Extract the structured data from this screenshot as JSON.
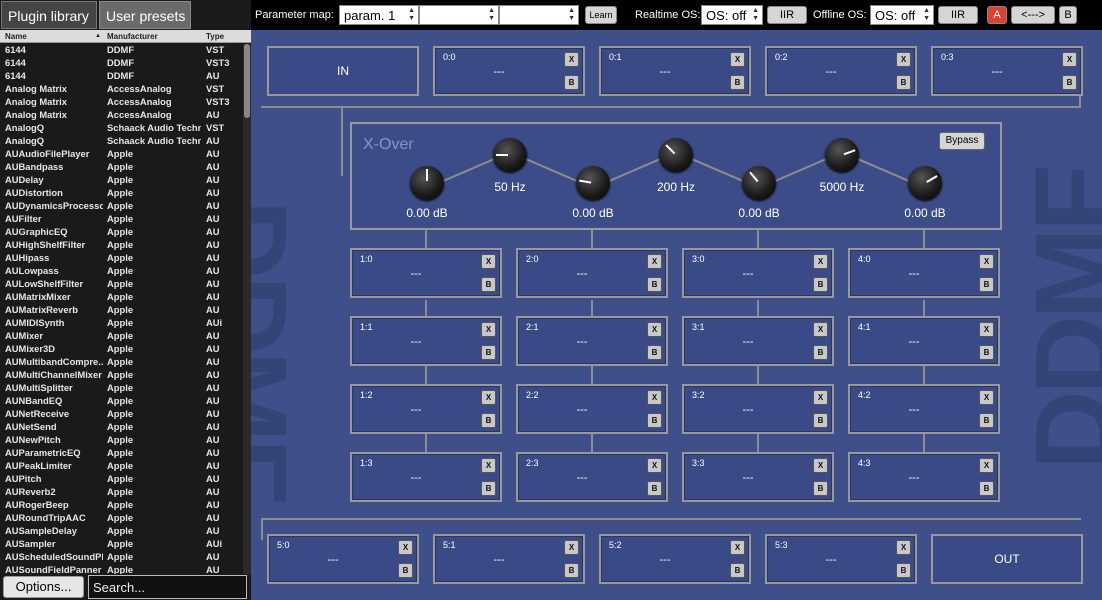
{
  "left_tabs": {
    "library": "Plugin library",
    "presets": "User presets"
  },
  "list_header": {
    "name": "Name",
    "manufacturer": "Manufacturer",
    "type": "Type"
  },
  "plugins": [
    [
      "6144",
      "DDMF",
      "VST"
    ],
    [
      "6144",
      "DDMF",
      "VST3"
    ],
    [
      "6144",
      "DDMF",
      "AU"
    ],
    [
      "Analog Matrix",
      "AccessAnalog",
      "VST"
    ],
    [
      "Analog Matrix",
      "AccessAnalog",
      "VST3"
    ],
    [
      "Analog Matrix",
      "AccessAnalog",
      "AU"
    ],
    [
      "AnalogQ",
      "Schaack Audio Techn...",
      "VST"
    ],
    [
      "AnalogQ",
      "Schaack Audio Techn...",
      "AU"
    ],
    [
      "AUAudioFilePlayer",
      "Apple",
      "AU"
    ],
    [
      "AUBandpass",
      "Apple",
      "AU"
    ],
    [
      "AUDelay",
      "Apple",
      "AU"
    ],
    [
      "AUDistortion",
      "Apple",
      "AU"
    ],
    [
      "AUDynamicsProcessor",
      "Apple",
      "AU"
    ],
    [
      "AUFilter",
      "Apple",
      "AU"
    ],
    [
      "AUGraphicEQ",
      "Apple",
      "AU"
    ],
    [
      "AUHighShelfFilter",
      "Apple",
      "AU"
    ],
    [
      "AUHipass",
      "Apple",
      "AU"
    ],
    [
      "AULowpass",
      "Apple",
      "AU"
    ],
    [
      "AULowShelfFilter",
      "Apple",
      "AU"
    ],
    [
      "AUMatrixMixer",
      "Apple",
      "AU"
    ],
    [
      "AUMatrixReverb",
      "Apple",
      "AU"
    ],
    [
      "AUMIDISynth",
      "Apple",
      "AUi"
    ],
    [
      "AUMixer",
      "Apple",
      "AU"
    ],
    [
      "AUMixer3D",
      "Apple",
      "AU"
    ],
    [
      "AUMultibandCompre...",
      "Apple",
      "AU"
    ],
    [
      "AUMultiChannelMixer",
      "Apple",
      "AU"
    ],
    [
      "AUMultiSplitter",
      "Apple",
      "AU"
    ],
    [
      "AUNBandEQ",
      "Apple",
      "AU"
    ],
    [
      "AUNetReceive",
      "Apple",
      "AU"
    ],
    [
      "AUNetSend",
      "Apple",
      "AU"
    ],
    [
      "AUNewPitch",
      "Apple",
      "AU"
    ],
    [
      "AUParametricEQ",
      "Apple",
      "AU"
    ],
    [
      "AUPeakLimiter",
      "Apple",
      "AU"
    ],
    [
      "AUPitch",
      "Apple",
      "AU"
    ],
    [
      "AUReverb2",
      "Apple",
      "AU"
    ],
    [
      "AURogerBeep",
      "Apple",
      "AU"
    ],
    [
      "AURoundTripAAC",
      "Apple",
      "AU"
    ],
    [
      "AUSampleDelay",
      "Apple",
      "AU"
    ],
    [
      "AUSampler",
      "Apple",
      "AUi"
    ],
    [
      "AUScheduledSoundPl...",
      "Apple",
      "AU"
    ],
    [
      "AUSoundFieldPanner",
      "Apple",
      "AU"
    ]
  ],
  "bottom": {
    "options": "Options...",
    "search_placeholder": "Search..."
  },
  "toolbar": {
    "param_map_label": "Parameter map:",
    "param_map_value": "param. 1",
    "param_map_value2": "",
    "param_map_value3": "",
    "learn": "Learn",
    "realtime_label": "Realtime OS:",
    "realtime_value": "OS: off",
    "iir1": "IIR",
    "offline_label": "Offline OS:",
    "offline_value": "OS: off",
    "iir2": "IIR",
    "a": "A",
    "swap": "<--->",
    "b": "B"
  },
  "watermark": "DDMF",
  "io": {
    "in": "IN",
    "out": "OUT"
  },
  "slot_empty": "---",
  "slot_x": "X",
  "slot_b": "B",
  "xover": {
    "title": "X-Over",
    "bypass": "Bypass",
    "gains": [
      "0.00 dB",
      "0.00 dB",
      "0.00 dB",
      "0.00 dB"
    ],
    "freqs": [
      "50 Hz",
      "200 Hz",
      "5000 Hz"
    ]
  },
  "slots": {
    "row0": [
      "0:0",
      "0:1",
      "0:2",
      "0:3"
    ],
    "grid": [
      [
        "1:0",
        "2:0",
        "3:0",
        "4:0"
      ],
      [
        "1:1",
        "2:1",
        "3:1",
        "4:1"
      ],
      [
        "1:2",
        "2:2",
        "3:2",
        "4:2"
      ],
      [
        "1:3",
        "2:3",
        "3:3",
        "4:3"
      ]
    ],
    "row5": [
      "5:0",
      "5:1",
      "5:2",
      "5:3"
    ]
  }
}
